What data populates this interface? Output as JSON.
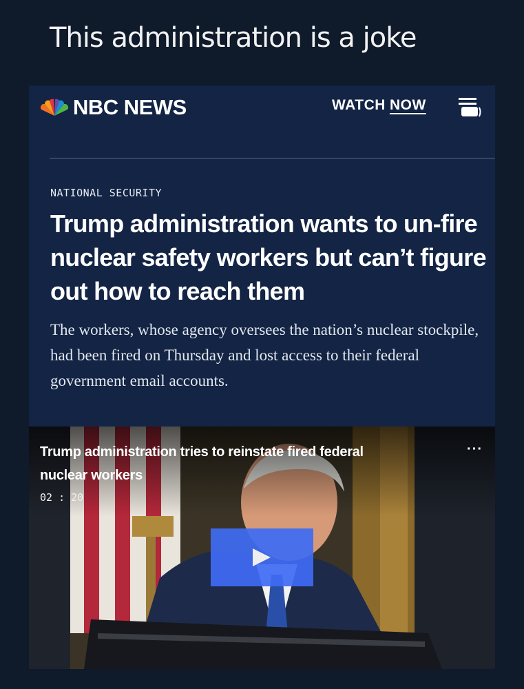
{
  "post": {
    "caption": "This administration is a joke"
  },
  "header": {
    "brand": "NBC NEWS",
    "watch_label": "WATCH",
    "now_label": "NOW",
    "menu_icon": "menu-icon"
  },
  "article": {
    "kicker": "NATIONAL SECURITY",
    "headline": "Trump administration wants to un-fire nuclear safety workers but can’t figure out how to reach them",
    "dek": "The workers, whose agency oversees the nation’s nuclear stockpile, had been fired on Thursday and lost access to their federal government email accounts."
  },
  "video": {
    "title": "Trump administration tries to reinstate fired federal nuclear workers",
    "duration": "02 : 20",
    "more_label": "···",
    "play_icon": "play-icon"
  },
  "colors": {
    "page_bg": "#0f1a2b",
    "card_bg": "#132444",
    "play_button": "#3f6cf5"
  }
}
